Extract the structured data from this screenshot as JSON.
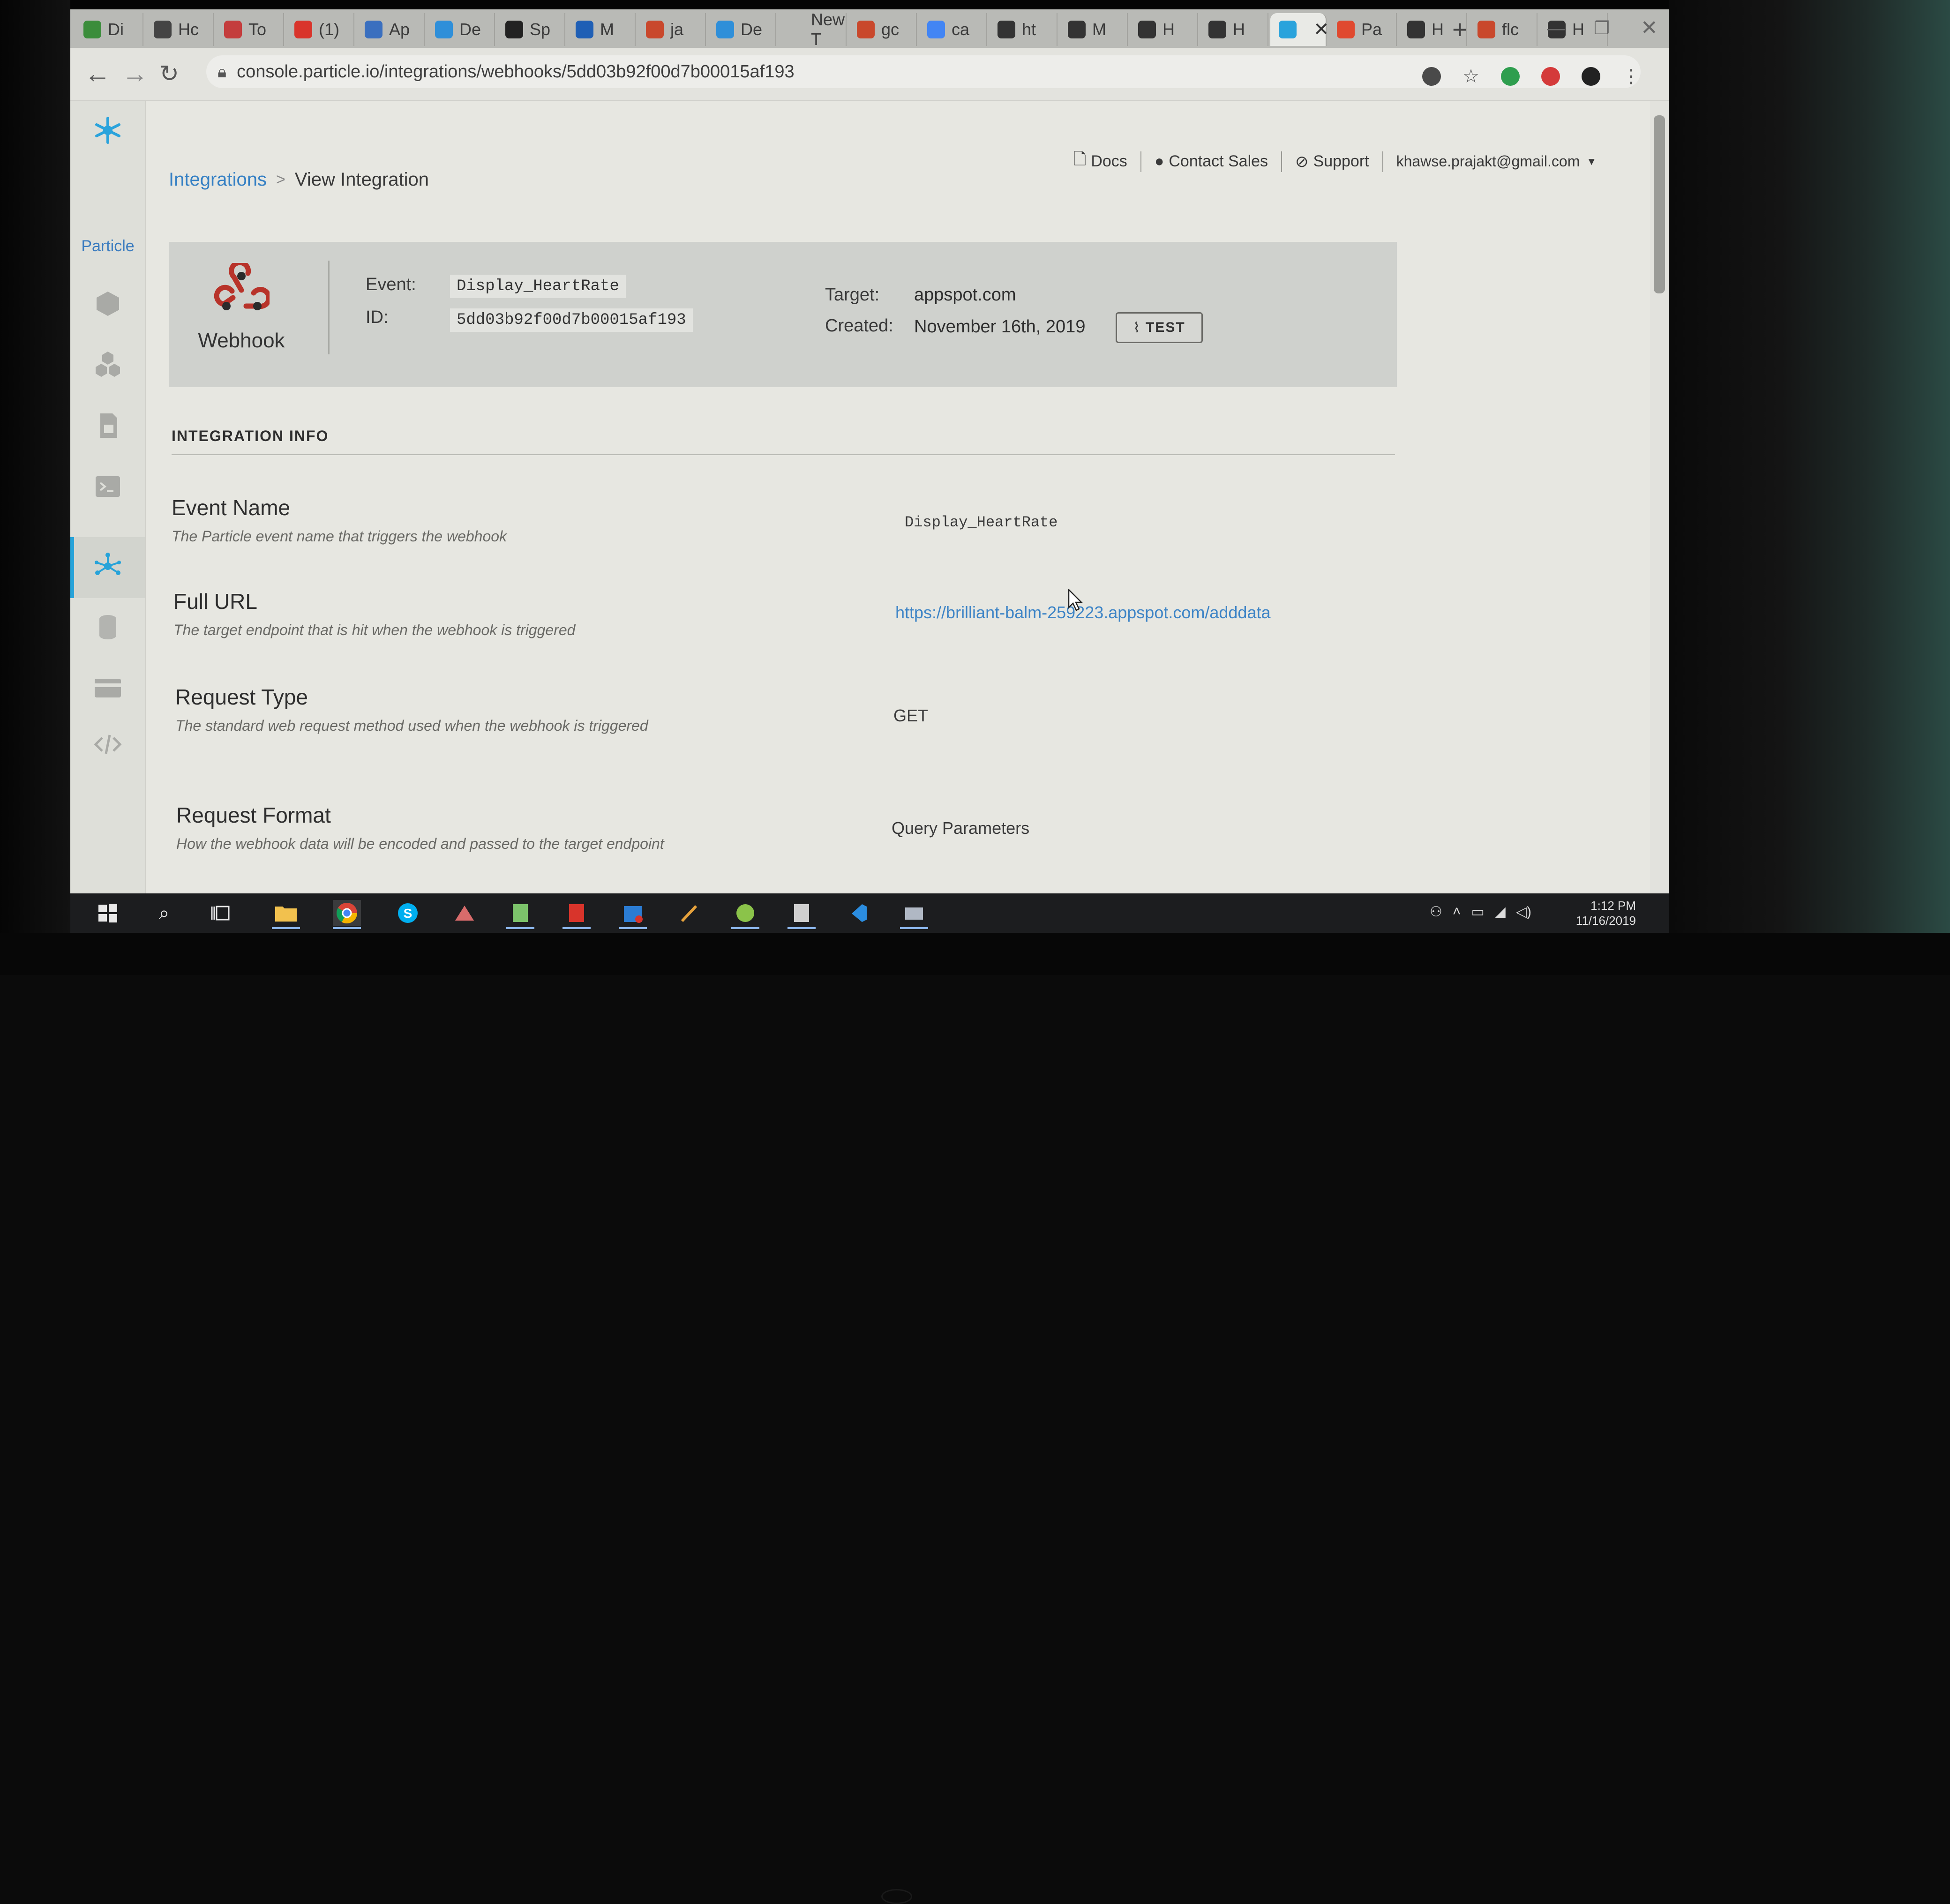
{
  "browser": {
    "tabs": [
      {
        "label": "Di",
        "color": "#3b8d3b"
      },
      {
        "label": "Hc",
        "color": "#444444"
      },
      {
        "label": "To",
        "color": "#c43d3d"
      },
      {
        "label": "(1)",
        "color": "#d9342b"
      },
      {
        "label": "Ap",
        "color": "#3a6fbf"
      },
      {
        "label": "De",
        "color": "#2f8fd9"
      },
      {
        "label": "Sp",
        "color": "#222222"
      },
      {
        "label": "M",
        "color": "#1f5fb5"
      },
      {
        "label": "ja",
        "color": "#c9482c"
      },
      {
        "label": "De",
        "color": "#2f8fd9"
      },
      {
        "label": "New T",
        "color": "#b9bab6"
      },
      {
        "label": "gc",
        "color": "#c9482c"
      },
      {
        "label": "ca",
        "color": "#4285f4"
      },
      {
        "label": "ht",
        "color": "#333333"
      },
      {
        "label": "M",
        "color": "#333333"
      },
      {
        "label": "H",
        "color": "#333333"
      },
      {
        "label": "H",
        "color": "#333333"
      }
    ],
    "active_tab": {
      "label": "",
      "color": "#2aa3dc"
    },
    "tabs_after": [
      {
        "label": "Pa",
        "color": "#e0492f"
      },
      {
        "label": "H",
        "color": "#333333"
      },
      {
        "label": "flc",
        "color": "#c9482c"
      },
      {
        "label": "H",
        "color": "#333333"
      }
    ],
    "url": "console.particle.io/integrations/webhooks/5dd03b92f00d7b00015af193"
  },
  "sidebar": {
    "brand": "Particle"
  },
  "header": {
    "docs": "Docs",
    "contact_sales": "Contact Sales",
    "support": "Support",
    "user_email": "khawse.prajakt@gmail.com"
  },
  "breadcrumb": {
    "parent": "Integrations",
    "separator": ">",
    "current": "View Integration"
  },
  "summary": {
    "type_label": "Webhook",
    "event_label": "Event:",
    "event_value": "Display_HeartRate",
    "id_label": "ID:",
    "id_value": "5dd03b92f00d7b00015af193",
    "target_label": "Target:",
    "target_value": "appspot.com",
    "created_label": "Created:",
    "created_value": "November 16th, 2019",
    "test_button": "TEST"
  },
  "integration_info": {
    "heading": "INTEGRATION INFO",
    "rows": [
      {
        "title": "Event Name",
        "description": "The Particle event name that triggers the webhook",
        "value": "Display_HeartRate"
      },
      {
        "title": "Full URL",
        "description": "The target endpoint that is hit when the webhook is triggered",
        "value": "https://brilliant-balm-259223.appspot.com/adddata"
      },
      {
        "title": "Request Type",
        "description": "The standard web request method used when the webhook is triggered",
        "value": "GET"
      },
      {
        "title": "Request Format",
        "description": "How the webhook data will be encoded and passed to the target endpoint",
        "value": "Query Parameters"
      }
    ]
  },
  "taskbar": {
    "time": "1:12 PM",
    "date": "11/16/2019"
  },
  "colors": {
    "accent": "#27a3d9",
    "link": "#3580c4",
    "webhook_icon": "#c0392b"
  }
}
